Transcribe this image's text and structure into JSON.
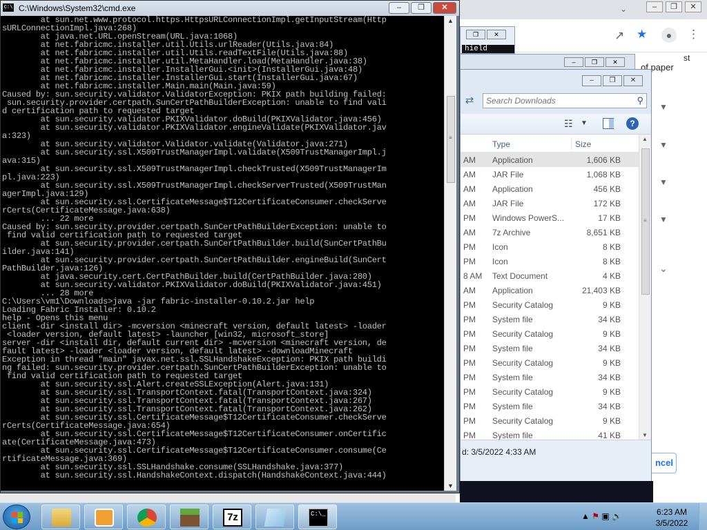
{
  "cmd": {
    "title": "C:\\Windows\\System32\\cmd.exe",
    "icon_text": "C:\\",
    "min": "–",
    "max": "❐",
    "close": "✕",
    "lines": [
      "        at sun.net.www.protocol.https.HttpsURLConnectionImpl.getInputStream(Http",
      "sURLConnectionImpl.java:268)",
      "        at java.net.URL.openStream(URL.java:1068)",
      "        at net.fabricmc.installer.util.Utils.urlReader(Utils.java:84)",
      "        at net.fabricmc.installer.util.Utils.readTextFile(Utils.java:88)",
      "        at net.fabricmc.installer.util.MetaHandler.load(MetaHandler.java:38)",
      "        at net.fabricmc.installer.InstallerGui.<init>(InstallerGui.java:48)",
      "        at net.fabricmc.installer.InstallerGui.start(InstallerGui.java:67)",
      "        at net.fabricmc.installer.Main.main(Main.java:59)",
      "Caused by: sun.security.validator.ValidatorException: PKIX path building failed:",
      " sun.security.provider.certpath.SunCertPathBuilderException: unable to find vali",
      "d certification path to requested target",
      "        at sun.security.validator.PKIXValidator.doBuild(PKIXValidator.java:456)",
      "        at sun.security.validator.PKIXValidator.engineValidate(PKIXValidator.jav",
      "a:323)",
      "        at sun.security.validator.Validator.validate(Validator.java:271)",
      "        at sun.security.ssl.X509TrustManagerImpl.validate(X509TrustManagerImpl.j",
      "ava:315)",
      "        at sun.security.ssl.X509TrustManagerImpl.checkTrusted(X509TrustManagerIm",
      "pl.java:223)",
      "        at sun.security.ssl.X509TrustManagerImpl.checkServerTrusted(X509TrustMan",
      "agerImpl.java:129)",
      "        at sun.security.ssl.CertificateMessage$T12CertificateConsumer.checkServe",
      "rCerts(CertificateMessage.java:638)",
      "        ... 22 more",
      "Caused by: sun.security.provider.certpath.SunCertPathBuilderException: unable to",
      " find valid certification path to requested target",
      "        at sun.security.provider.certpath.SunCertPathBuilder.build(SunCertPathBu",
      "ilder.java:141)",
      "        at sun.security.provider.certpath.SunCertPathBuilder.engineBuild(SunCert",
      "PathBuilder.java:126)",
      "        at java.security.cert.CertPathBuilder.build(CertPathBuilder.java:280)",
      "        at sun.security.validator.PKIXValidator.doBuild(PKIXValidator.java:451)",
      "        ... 28 more",
      "",
      "C:\\Users\\vm1\\Downloads>java -jar fabric-installer-0.10.2.jar help",
      "Loading Fabric Installer: 0.10.2",
      "help - Opens this menu",
      "client -dir <install dir> -mcversion <minecraft version, default latest> -loader",
      " <loader version, default latest> -launcher [win32, microsoft_store]",
      "server -dir <install dir, default current dir> -mcversion <minecraft version, de",
      "fault latest> -loader <loader version, default latest> -downloadMinecraft",
      "Exception in thread \"main\" javax.net.ssl.SSLHandshakeException: PKIX path buildi",
      "ng failed: sun.security.provider.certpath.SunCertPathBuilderException: unable to",
      " find valid certification path to requested target",
      "        at sun.security.ssl.Alert.createSSLException(Alert.java:131)",
      "        at sun.security.ssl.TransportContext.fatal(TransportContext.java:324)",
      "        at sun.security.ssl.TransportContext.fatal(TransportContext.java:267)",
      "        at sun.security.ssl.TransportContext.fatal(TransportContext.java:262)",
      "        at sun.security.ssl.CertificateMessage$T12CertificateConsumer.checkServe",
      "rCerts(CertificateMessage.java:654)",
      "        at sun.security.ssl.CertificateMessage$T12CertificateConsumer.onCertific",
      "ate(CertificateMessage.java:473)",
      "        at sun.security.ssl.CertificateMessage$T12CertificateConsumer.consume(Ce",
      "rtificateMessage.java:369)",
      "        at sun.security.ssl.SSLHandshake.consume(SSLHandshake.java:377)",
      "        at sun.security.ssl.HandshakeContext.dispatch(HandshakeContext.java:444)"
    ]
  },
  "background_browser": {
    "snippet_text": "of paper",
    "snippet_text2": "st",
    "cancel_label": "ncel"
  },
  "window3": {
    "console_fragment": "hield"
  },
  "explorer": {
    "search_placeholder": "Search Downloads",
    "columns": {
      "type": "Type",
      "size": "Size"
    },
    "rows": [
      {
        "date": "AM",
        "type": "Application",
        "size": "1,606 KB",
        "selected": true
      },
      {
        "date": "AM",
        "type": "JAR File",
        "size": "1,068 KB"
      },
      {
        "date": "AM",
        "type": "Application",
        "size": "456 KB"
      },
      {
        "date": "AM",
        "type": "JAR File",
        "size": "172 KB"
      },
      {
        "date": "PM",
        "type": "Windows PowerS...",
        "size": "17 KB"
      },
      {
        "date": "AM",
        "type": "7z Archive",
        "size": "8,651 KB"
      },
      {
        "date": "PM",
        "type": "Icon",
        "size": "8 KB"
      },
      {
        "date": "PM",
        "type": "Icon",
        "size": "8 KB"
      },
      {
        "date": "8 AM",
        "type": "Text Document",
        "size": "4 KB"
      },
      {
        "date": "AM",
        "type": "Application",
        "size": "21,403 KB"
      },
      {
        "date": "PM",
        "type": "Security Catalog",
        "size": "9 KB"
      },
      {
        "date": "PM",
        "type": "System file",
        "size": "34 KB"
      },
      {
        "date": "PM",
        "type": "Security Catalog",
        "size": "9 KB"
      },
      {
        "date": "PM",
        "type": "System file",
        "size": "34 KB"
      },
      {
        "date": "PM",
        "type": "Security Catalog",
        "size": "9 KB"
      },
      {
        "date": "PM",
        "type": "System file",
        "size": "34 KB"
      },
      {
        "date": "PM",
        "type": "Security Catalog",
        "size": "9 KB"
      },
      {
        "date": "PM",
        "type": "System file",
        "size": "34 KB"
      },
      {
        "date": "PM",
        "type": "Security Catalog",
        "size": "9 KB"
      },
      {
        "date": "PM",
        "type": "System file",
        "size": "41 KB"
      }
    ],
    "details": "d: 3/5/2022 4:33 AM"
  },
  "taskbar": {
    "apps": [
      {
        "name": "explorer",
        "icon": "folder-icon"
      },
      {
        "name": "media-player",
        "icon": "media-player-icon"
      },
      {
        "name": "chrome",
        "icon": "chrome-icon"
      },
      {
        "name": "minecraft",
        "icon": "minecraft-icon"
      },
      {
        "name": "7zip",
        "icon": "7zip-icon",
        "label": "7z"
      },
      {
        "name": "notepad",
        "icon": "notepad-icon"
      },
      {
        "name": "cmd",
        "icon": "cmd-icon"
      }
    ],
    "time": "6:23 AM",
    "date": "3/5/2022"
  }
}
